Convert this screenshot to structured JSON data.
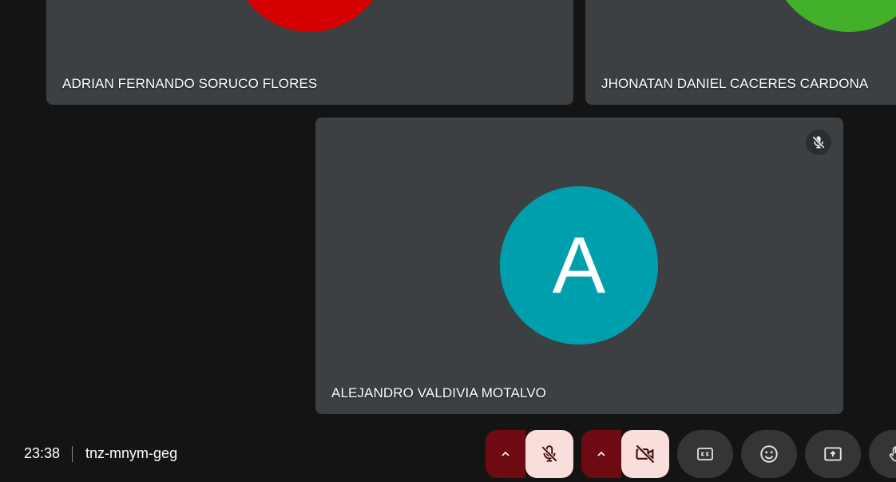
{
  "participants": [
    {
      "name": "ADRIAN FERNANDO SORUCO FLORES",
      "avatar_color": "#d50000"
    },
    {
      "name": "JHONATAN DANIEL CACERES CARDONA",
      "avatar_color": "#43b02a"
    },
    {
      "name": "ALEJANDRO VALDIVIA MOTALVO",
      "avatar_color": "#009fae",
      "avatar_letter": "A",
      "muted_icon": "mic-off-icon"
    }
  ],
  "footer": {
    "time": "23:38",
    "meeting_code": "tnz-mnym-geg"
  },
  "controls": {
    "mic": {
      "icon": "mic-off-icon",
      "state": "off",
      "color": "#f9dedc",
      "menu_icon": "chevron-up-icon"
    },
    "camera": {
      "icon": "videocam-off-icon",
      "state": "off",
      "color": "#f9dedc",
      "menu_icon": "chevron-up-icon"
    },
    "captions": {
      "icon": "closed-captions-icon"
    },
    "reactions": {
      "icon": "emoji-icon"
    },
    "present": {
      "icon": "present-screen-icon"
    },
    "raise_hand": {
      "icon": "raise-hand-icon"
    }
  },
  "colors": {
    "background": "#141414",
    "tile": "#3c4043",
    "control_button": "#333537",
    "danger_dark": "#6d0a12"
  }
}
